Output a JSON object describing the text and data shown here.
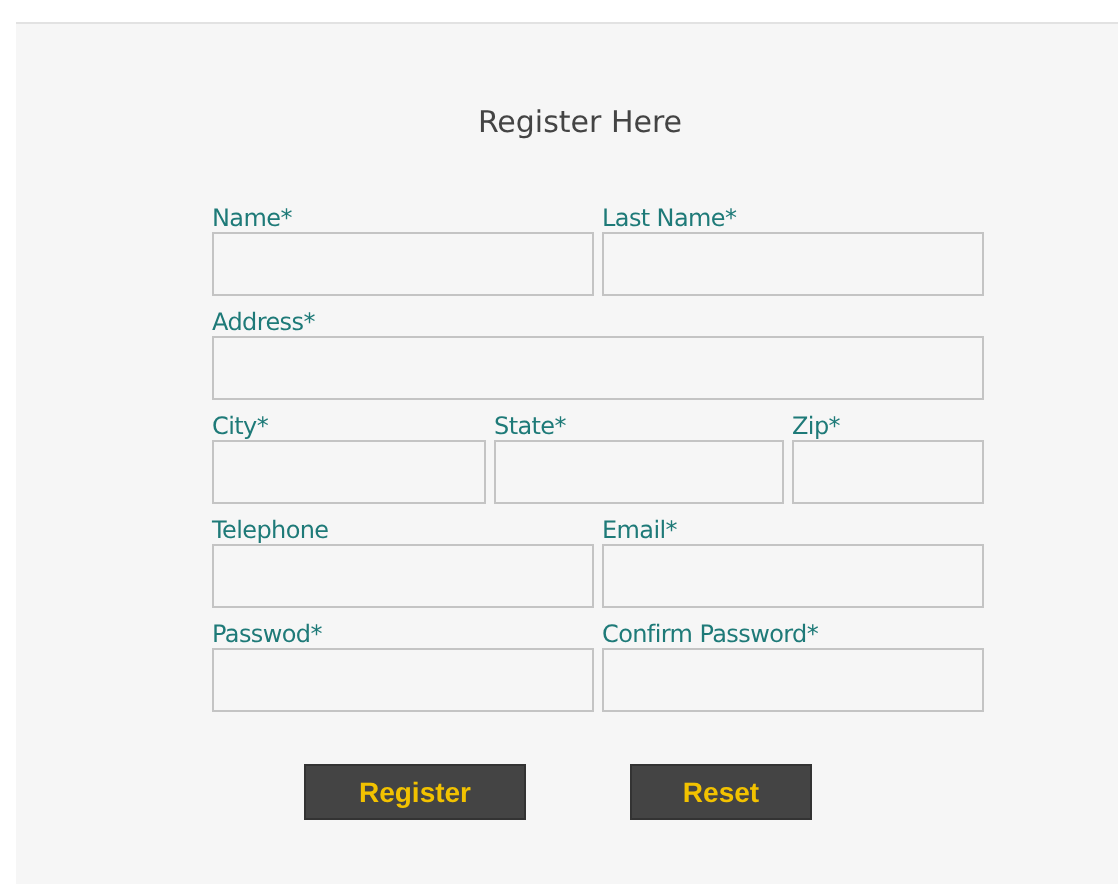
{
  "title": "Register Here",
  "rows": [
    {
      "fields": [
        {
          "label": "Name*"
        },
        {
          "label": "Last Name*"
        }
      ]
    },
    {
      "fields": [
        {
          "label": "Address*"
        }
      ]
    },
    {
      "fields": [
        {
          "label": "City*"
        },
        {
          "label": "State*"
        },
        {
          "label": "Zip*"
        }
      ]
    },
    {
      "fields": [
        {
          "label": "Telephone"
        },
        {
          "label": "Email*"
        }
      ]
    },
    {
      "fields": [
        {
          "label": "Passwod*"
        },
        {
          "label": "Confirm Password*"
        }
      ]
    }
  ],
  "buttons": [
    {
      "label": "Register"
    },
    {
      "label": "Reset"
    }
  ]
}
